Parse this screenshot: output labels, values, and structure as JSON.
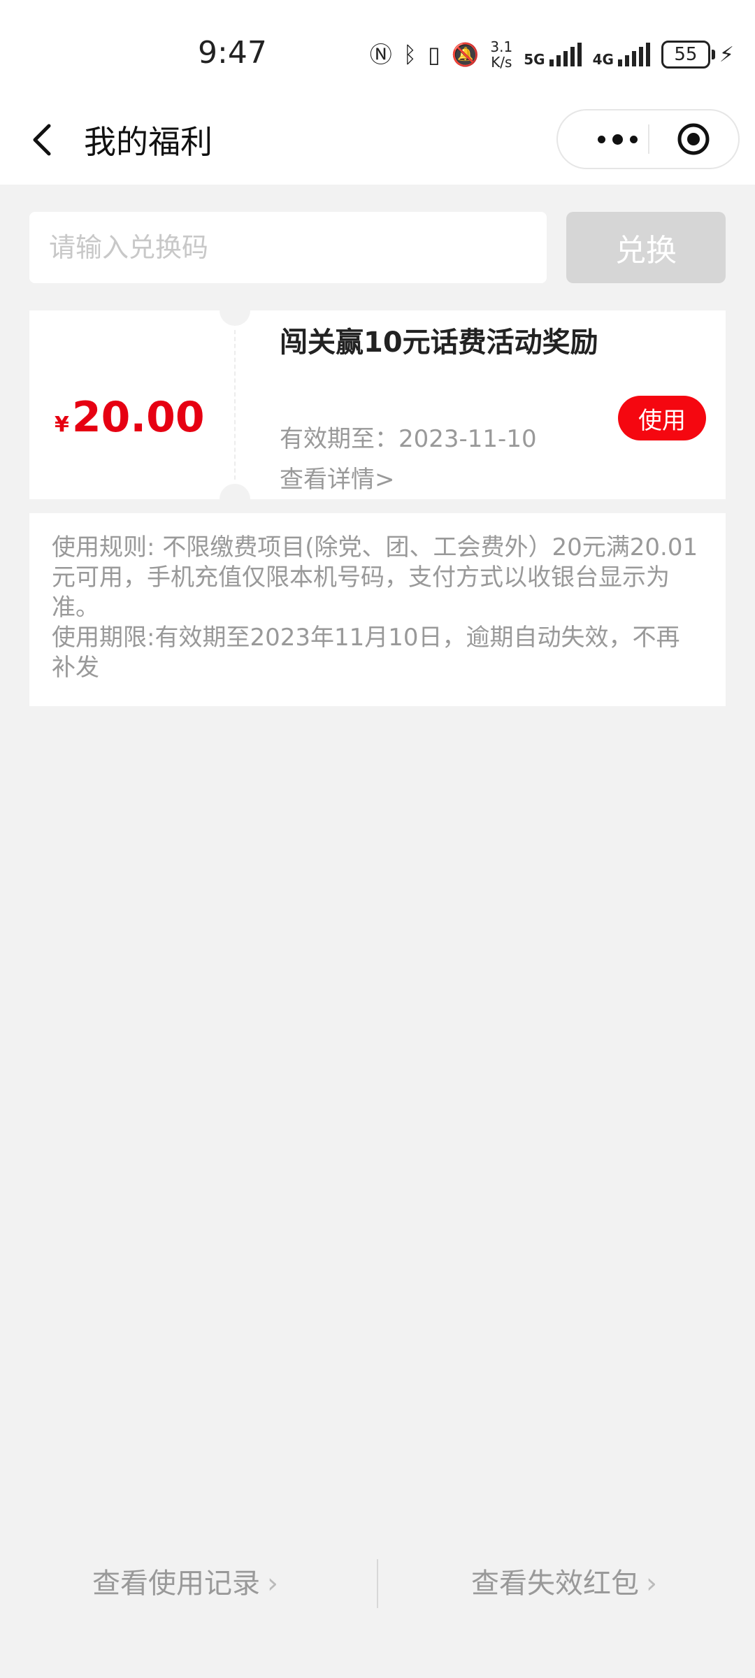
{
  "status_bar": {
    "time": "9:47",
    "net_speed_value": "3.1",
    "net_speed_unit": "K/s",
    "sig1_label": "5G",
    "sig2_label": "4G",
    "battery": "55"
  },
  "header": {
    "title": "我的福利",
    "back_icon": "chevron-left-icon",
    "more_icon": "more-dots-icon",
    "close_icon": "target-icon"
  },
  "redeem": {
    "placeholder": "请输入兑换码",
    "button_label": "兑换"
  },
  "coupon": {
    "currency": "¥",
    "amount": "20.00",
    "title": "闯关赢10元话费活动奖励",
    "expiry": "有效期至：2023-11-10",
    "detail_link": "查看详情>",
    "use_label": "使用"
  },
  "rules": {
    "line1": "使用规则: 不限缴费项目(除党、团、工会费外）20元满20.01元可用，手机充值仅限本机号码，支付方式以收银台显示为准。",
    "line2": "使用期限:有效期至2023年11月10日，逾期自动失效，不再补发"
  },
  "footer": {
    "left_link": "查看使用记录",
    "right_link": "查看失效红包"
  },
  "colors": {
    "accent_red": "#e60012",
    "background": "#f2f2f2"
  }
}
